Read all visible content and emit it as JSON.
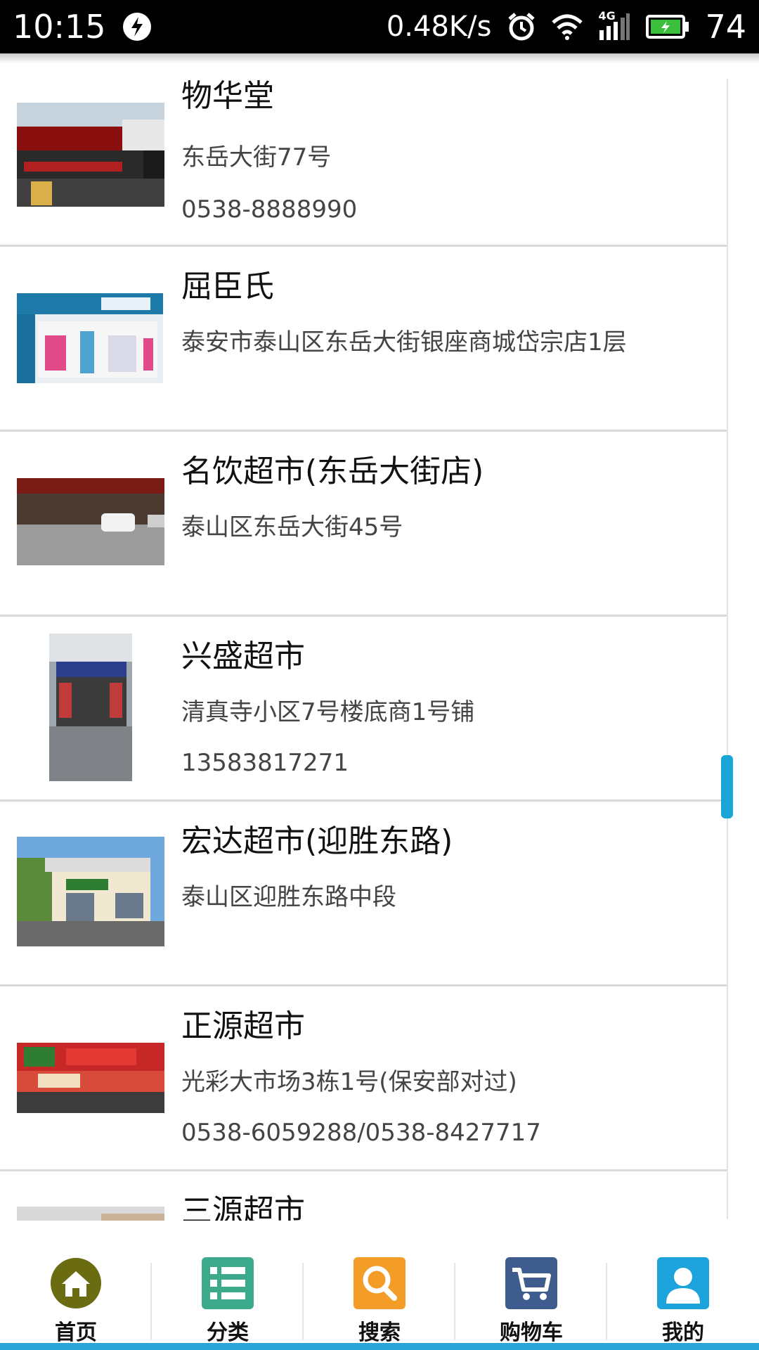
{
  "status_bar": {
    "time": "10:15",
    "net_speed": "0.48K/s",
    "network": "4G",
    "battery": "74"
  },
  "stores": [
    {
      "name": "物华堂",
      "address": "东岳大街77号",
      "phone": "0538-8888990"
    },
    {
      "name": "屈臣氏",
      "address": "泰安市泰山区东岳大街银座商城岱宗店1层",
      "phone": ""
    },
    {
      "name": "名饮超市(东岳大街店)",
      "address": "泰山区东岳大街45号",
      "phone": ""
    },
    {
      "name": "兴盛超市",
      "address": "清真寺小区7号楼底商1号铺",
      "phone": "13583817271"
    },
    {
      "name": "宏达超市(迎胜东路)",
      "address": "泰山区迎胜东路中段",
      "phone": ""
    },
    {
      "name": "正源超市",
      "address": "光彩大市场3栋1号(保安部对过)",
      "phone": "0538-6059288/0538-8427717"
    },
    {
      "name": "三源超市",
      "address": "",
      "phone": ""
    }
  ],
  "bottom_nav": [
    {
      "label": "首页",
      "icon": "home-icon",
      "color": "#6b6b12"
    },
    {
      "label": "分类",
      "icon": "list-icon",
      "color": "#3daa8c"
    },
    {
      "label": "搜索",
      "icon": "search-icon",
      "color": "#f39c28"
    },
    {
      "label": "购物车",
      "icon": "cart-icon",
      "color": "#3e5c8e"
    },
    {
      "label": "我的",
      "icon": "user-icon",
      "color": "#1da3dc"
    }
  ],
  "colors": {
    "accent": "#2aa6d6",
    "divider": "#d9d9d9"
  }
}
